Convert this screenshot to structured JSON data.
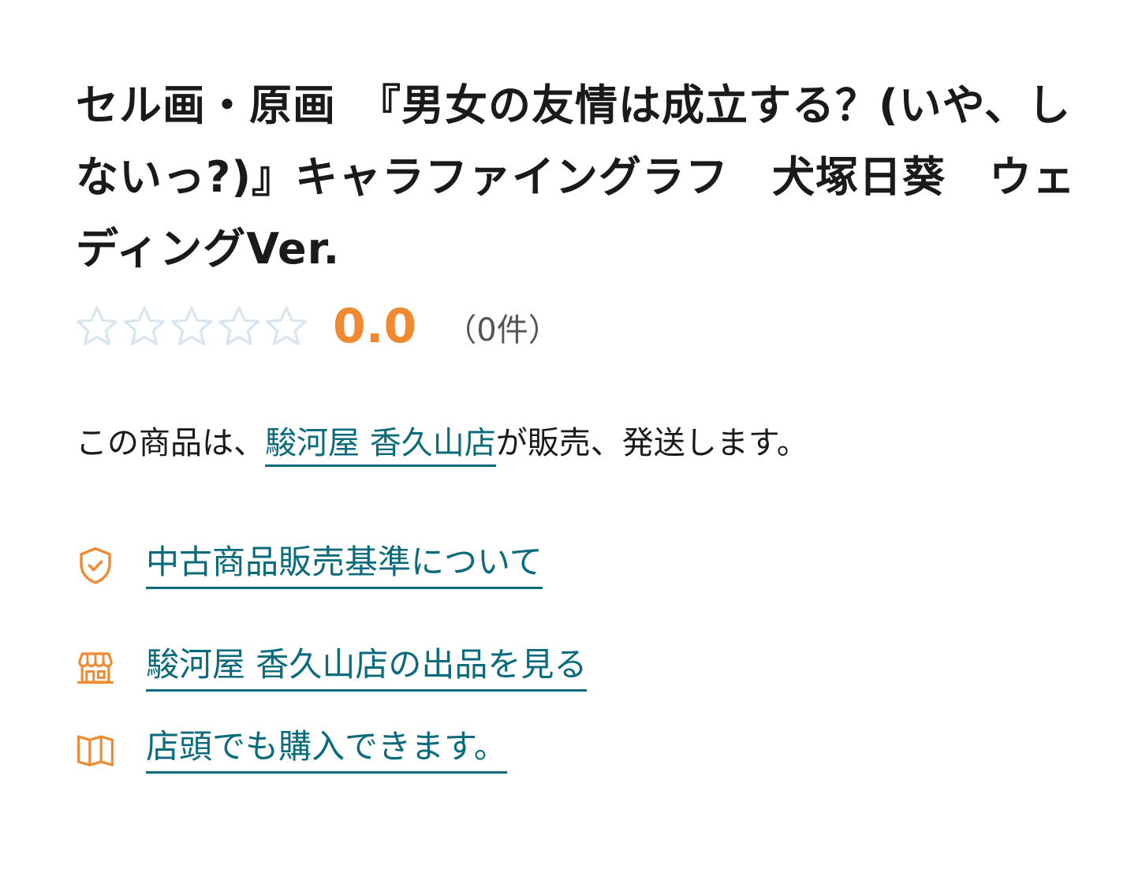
{
  "product": {
    "title": "セル画・原画　『男女の友情は成立する？(いや、しないっ?)』キャラファイングラフ　犬塚日葵　ウェディングVer."
  },
  "rating": {
    "stars_total": 5,
    "stars_filled": 0,
    "score": "0.0",
    "count_label": "（0件）"
  },
  "seller": {
    "prefix": "この商品は、",
    "store_name": "駿河屋 香久山店",
    "suffix": "が販売、発送します。"
  },
  "links": {
    "used_standard": {
      "label": "中古商品販売基準について",
      "icon": "shield-check-icon"
    },
    "store_listings": {
      "label": "駿河屋 香久山店の出品を見る",
      "icon": "storefront-icon"
    },
    "in_store_purchase": {
      "label": "店頭でも購入できます。",
      "icon": "map-icon"
    }
  },
  "colors": {
    "accent_orange": "#f0892f",
    "link_teal": "#0c6b7a",
    "star_empty": "#d9e6ee",
    "text": "#1a1a1a",
    "muted": "#555555"
  }
}
